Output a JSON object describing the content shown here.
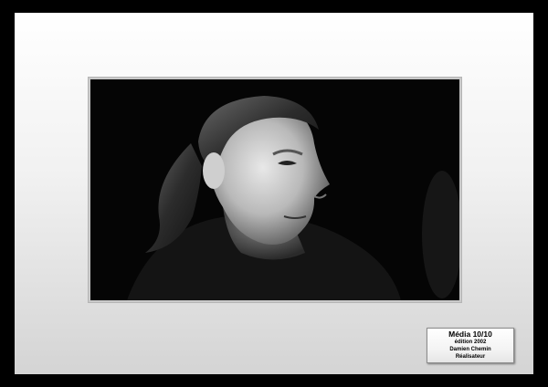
{
  "caption": {
    "title": "Média 10/10",
    "edition": "édition 2002",
    "name": "Damien Chemin",
    "role": "Réalisateur"
  },
  "photo": {
    "subject": "black-and-white portrait photograph"
  },
  "colors": {
    "frame": "#000000",
    "mat": "#f1f1f1",
    "photo_background": "#050505",
    "caption_plate": "#f4f4f4"
  }
}
